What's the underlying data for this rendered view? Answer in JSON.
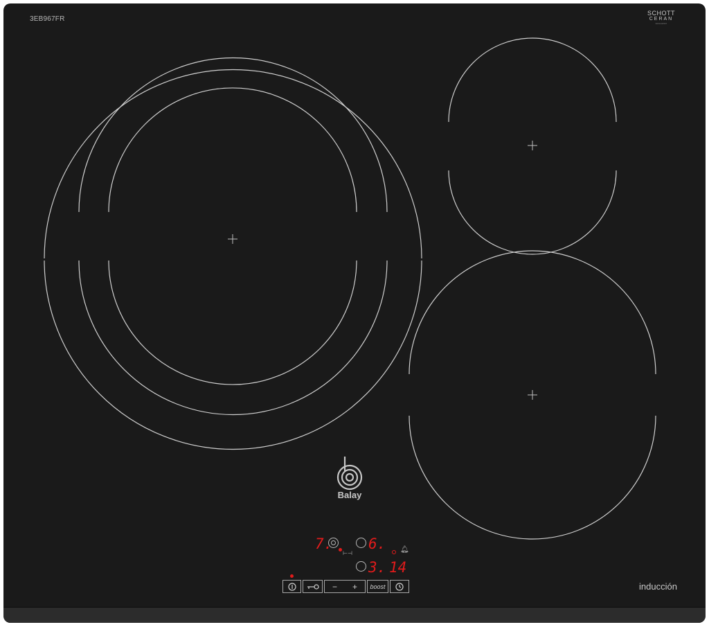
{
  "hob": {
    "model": "3EB967FR",
    "glass_brand_line1": "SCHOTT",
    "glass_brand_line2": "CERAN",
    "glass_brand_small": "9001234567",
    "brand": "Balay",
    "type_label": "inducción"
  },
  "display": {
    "zone_left_level": "7.",
    "zone_right_level": "6.",
    "zone_bottom_level": "3.",
    "timer_value": "14"
  },
  "controls": {
    "power_icon": "power-icon",
    "lock_icon": "key-lock-icon",
    "minus_label": "−",
    "plus_label": "+",
    "boost_label": "boost",
    "timer_icon": "clock-icon"
  },
  "colors": {
    "glass": "#1a1a1a",
    "ring": "#d0d0d0",
    "display_red": "#e11b1b"
  }
}
